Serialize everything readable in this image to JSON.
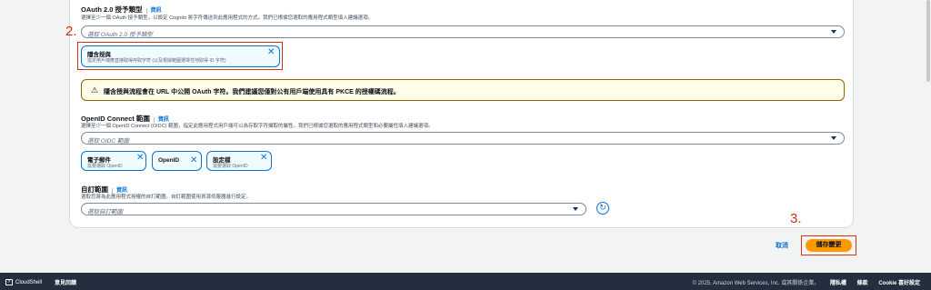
{
  "oauth_section": {
    "title": "OAuth 2.0 授予類型",
    "info": "資訊",
    "description": "選擇至少一個 OAuth 授予類型，以設定 Cognito 將字符傳送到此應用程式的方式。我們已根據您選取的應用程式類型填入建議選項。",
    "placeholder": "選取 OAuth 2.0 授予類型",
    "token": {
      "label": "隱含授與",
      "sub": "指定用戶端應直接取得存取字符 (以及根據範圍選擇性地取得 ID 字符)"
    }
  },
  "alert": {
    "icon": "warning-icon",
    "message": "隱含授與流程會在 URL 中公開 OAuth 字符。我們建議您僅對公有用戶端使用具有 PKCE 的授權碼流程。"
  },
  "oidc_section": {
    "title": "OpenID Connect 範圍",
    "info": "資訊",
    "description": "選擇至少一個 OpenID Connect (OIDC) 範圍，指定此應用程式用戶端可以為存取字符擷取的屬性。我們已根據您選取的應用程式類型和必要屬性填入建議選項。",
    "placeholder": "選取 OIDC 範圍",
    "tokens": [
      {
        "label": "電子郵件",
        "sub": "需要選取 OpenID"
      },
      {
        "label": "OpenID",
        "sub": ""
      },
      {
        "label": "設定檔",
        "sub": "需要選取 OpenID"
      }
    ]
  },
  "custom_section": {
    "title": "自訂範圍",
    "info": "資訊",
    "description": "選取您將為此應用程式授權的自訂範圍。自訂範圍使用資源伺服器進行設定。",
    "placeholder": "選取自訂範圍"
  },
  "annotations": {
    "step2": "2.",
    "step3": "3."
  },
  "actions": {
    "cancel": "取消",
    "save": "儲存變更"
  },
  "footer": {
    "cloudshell": "CloudShell",
    "feedback": "意見回饋",
    "copyright": "© 2025, Amazon Web Services, Inc. 或其關係企業。",
    "privacy": "隱私權",
    "terms": "條款",
    "cookie": "Cookie 喜好設定"
  },
  "colors": {
    "accent": "#0972d3",
    "primary_button": "#ff9900",
    "annotation": "#d13212",
    "footer_bg": "#232f3e"
  }
}
